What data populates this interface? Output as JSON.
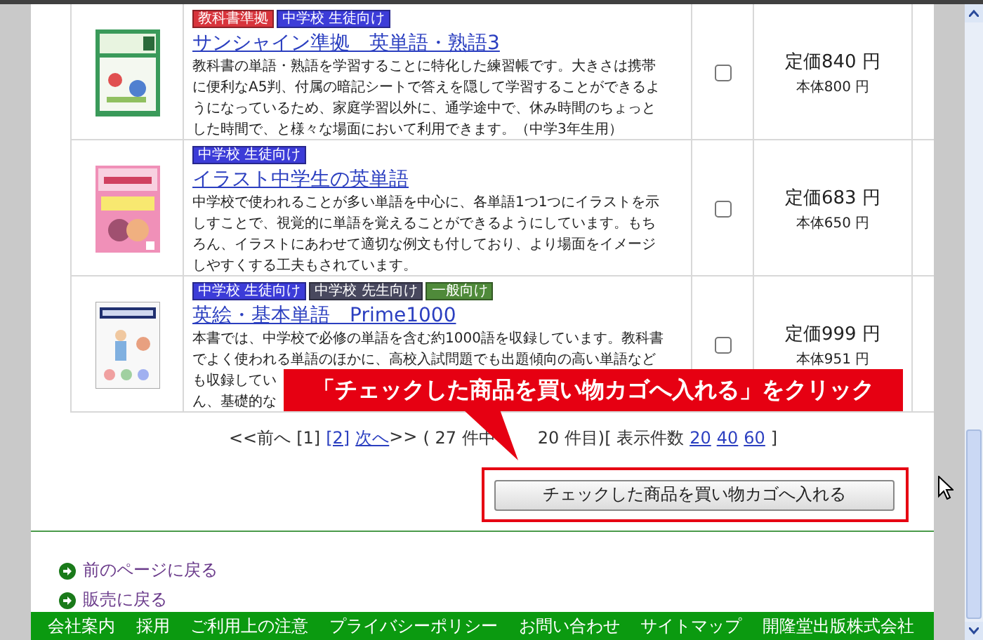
{
  "products": [
    {
      "badges": [
        {
          "label": "教科書準拠",
          "color": "#d8343c"
        },
        {
          "label": "中学校 生徒向け",
          "color": "#3c3cd8"
        }
      ],
      "title": "サンシャイン準拠　英単語・熟語3",
      "description_lines": [
        "教科書の単語・熟語を学習することに特化した練習帳です。大きさは携帯",
        "に便利なA5判、付属の暗記シートで答えを隠して学習することができるよ",
        "うになっているため、家庭学習以外に、通学途中で、休み時間のちょっと",
        "した時間で、と様々な場面において利用できます。（中学3年生用）"
      ],
      "checked": false,
      "price": "定価840 円",
      "base_price": "本体800 円"
    },
    {
      "badges": [
        {
          "label": "中学校 生徒向け",
          "color": "#3c3cd8"
        }
      ],
      "title": "イラスト中学生の英単語",
      "description_lines": [
        "中学校で使われることが多い単語を中心に、各単語1つ1つにイラストを示",
        "しすことで、視覚的に単語を覚えることができるようにしています。もち",
        "ろん、イラストにあわせて適切な例文も付しており、より場面をイメージ",
        "しやすくする工夫もされています。"
      ],
      "checked": false,
      "price": "定価683 円",
      "base_price": "本体650 円"
    },
    {
      "badges": [
        {
          "label": "中学校 生徒向け",
          "color": "#3c3cd8"
        },
        {
          "label": "中学校 先生向け",
          "color": "#48485e"
        },
        {
          "label": "一般向け",
          "color": "#4f8a3a"
        }
      ],
      "title": "英絵・基本単語　Prime1000",
      "description_lines": [
        "本書では、中学校で必修の単語を含む約1000語を収録しています。教科書",
        "でよく使われる単語のほかに、高校入試問題でも出題傾向の高い単語など",
        "も収録してい",
        "ん、基礎的な"
      ],
      "checked": false,
      "price": "定価999 円",
      "base_price": "本体951 円"
    }
  ],
  "pagination": {
    "prev": "<<前へ",
    "pages": [
      {
        "label": "[1]",
        "selected": true
      },
      {
        "label": "[2]",
        "selected": false
      }
    ],
    "next": "次へ",
    "next_mark": ">>",
    "count_before": "( 27 件中",
    "count_after": "20 件目)[ 表示件数",
    "per_page": [
      "20",
      "40",
      "60"
    ],
    "close": "]"
  },
  "cart_button": {
    "label": "チェックした商品を買い物カゴへ入れる"
  },
  "callout": {
    "text": "「チェックした商品を買い物カゴへ入れる」をクリック"
  },
  "back_links": [
    "前のページに戻る",
    "販売に戻る"
  ],
  "footer_links": [
    "会社案内",
    "採用",
    "ご利用上の注意",
    "プライバシーポリシー",
    "お問い合わせ",
    "サイトマップ",
    "開隆堂出版株式会社"
  ]
}
